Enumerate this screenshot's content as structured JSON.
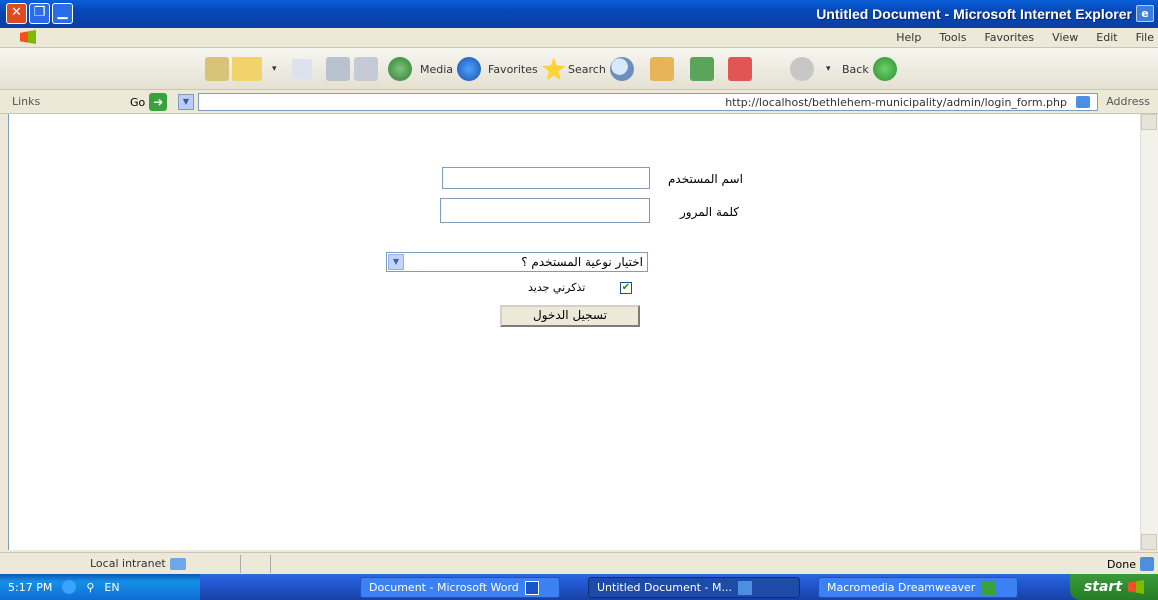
{
  "window": {
    "title": "Untitled Document - Microsoft Internet Explorer",
    "close": "✕",
    "maximize": "❐",
    "minimize": "▁"
  },
  "menu": [
    "Help",
    "Tools",
    "Favorites",
    "View",
    "Edit",
    "File"
  ],
  "toolbar": {
    "back": "Back",
    "search": "Search",
    "favorites": "Favorites",
    "media": "Media"
  },
  "address": {
    "links": "Links",
    "go": "Go",
    "url": "http://localhost/bethlehem-municipality/admin/login_form.php",
    "label": "Address"
  },
  "form": {
    "username_label": "اسم المستخدم",
    "password_label": "كلمة المرور",
    "user_type_selected": "اختيار نوعية المستخدم ؟",
    "remember_label": "تذكرني جديد",
    "login_button": "تسجيل الدخول"
  },
  "status": {
    "done": "Done",
    "zone": "Local intranet"
  },
  "taskbar": {
    "time": "5:17 PM",
    "lang": "EN",
    "tasks": [
      "Document - Microsoft Word",
      "Untitled Document - M...",
      "Macromedia Dreamweaver"
    ],
    "start": "start"
  },
  "icons": [
    "close-icon",
    "maximize-icon",
    "minimize-icon",
    "windows-flag-icon",
    "back-icon",
    "forward-icon",
    "stop-icon",
    "refresh-icon",
    "home-icon",
    "search-icon",
    "favorites-icon",
    "media-icon",
    "history-icon",
    "mail-icon",
    "print-icon",
    "edit-icon",
    "discuss-icon",
    "go-icon",
    "ie-page-icon",
    "intranet-icon"
  ],
  "colors": {
    "title_bar": "#0b3fa4",
    "taskbar": "#245edb",
    "start": "#2f8c2f",
    "window_bg": "#ece9d8"
  }
}
